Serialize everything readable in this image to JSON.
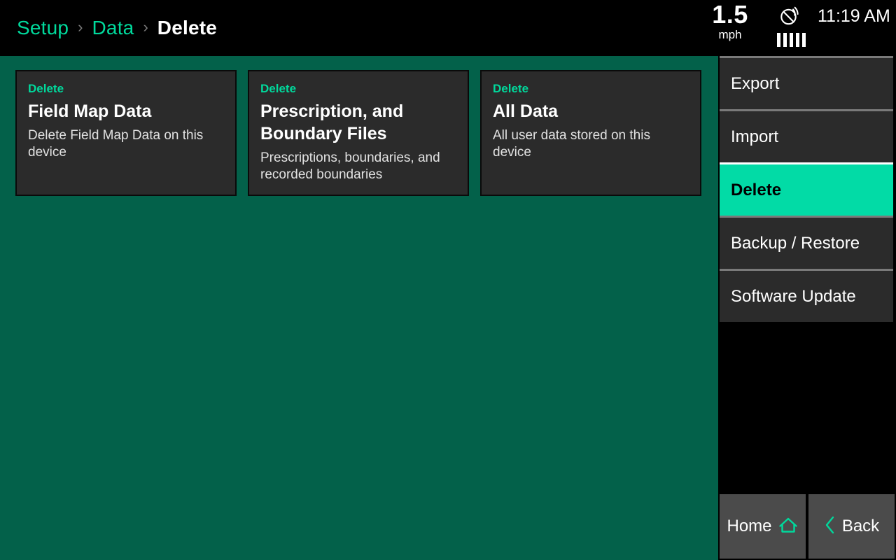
{
  "breadcrumb": {
    "items": [
      {
        "label": "Setup",
        "current": false
      },
      {
        "label": "Data",
        "current": false
      },
      {
        "label": "Delete",
        "current": true
      }
    ],
    "separator": "›"
  },
  "status": {
    "speed_value": "1.5",
    "speed_unit": "mph",
    "gps_icon": "satellite-dish-icon",
    "gps_signal_bars": 5,
    "time": "11:19 AM"
  },
  "main": {
    "cards": [
      {
        "label": "Delete",
        "title": "Field Map Data",
        "description": "Delete Field Map Data on this device"
      },
      {
        "label": "Delete",
        "title": "Prescription, and Boundary Files",
        "description": "Prescriptions, boundaries, and recorded boundaries"
      },
      {
        "label": "Delete",
        "title": "All Data",
        "description": "All user data stored on this device"
      }
    ]
  },
  "sidebar": {
    "items": [
      {
        "label": "Export",
        "active": false
      },
      {
        "label": "Import",
        "active": false
      },
      {
        "label": "Delete",
        "active": true
      },
      {
        "label": "Backup / Restore",
        "active": false
      },
      {
        "label": "Software Update",
        "active": false
      }
    ]
  },
  "bottom_nav": {
    "home": {
      "label": "Home",
      "icon": "home-icon"
    },
    "back": {
      "label": "Back",
      "icon": "chevron-left-icon"
    }
  },
  "colors": {
    "accent_teal": "#00d99c",
    "active_teal": "#02dba6",
    "content_green": "#03614a",
    "card_gray": "#2b2b2b",
    "panel_black": "#000000",
    "nav_button_gray": "#4b4b4b"
  }
}
